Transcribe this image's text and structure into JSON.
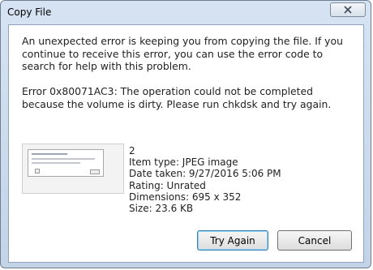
{
  "window": {
    "title": "Copy File",
    "close_icon": "close-icon"
  },
  "message": {
    "main": "An unexpected error is keeping you from copying the file. If you continue to receive this error, you can use the error code to search for help with this problem.",
    "error": "Error 0x80071AC3: The operation could not be completed because the volume is dirty. Please run chkdsk and try again."
  },
  "file": {
    "name": "2",
    "item_type": "Item type: JPEG image",
    "date_taken": "Date taken: 9/27/2016 5:06 PM",
    "rating": "Rating: Unrated",
    "dimensions": "Dimensions: 695 x 352",
    "size": "Size: 23.6 KB"
  },
  "buttons": {
    "try_again": "Try Again",
    "cancel": "Cancel"
  }
}
